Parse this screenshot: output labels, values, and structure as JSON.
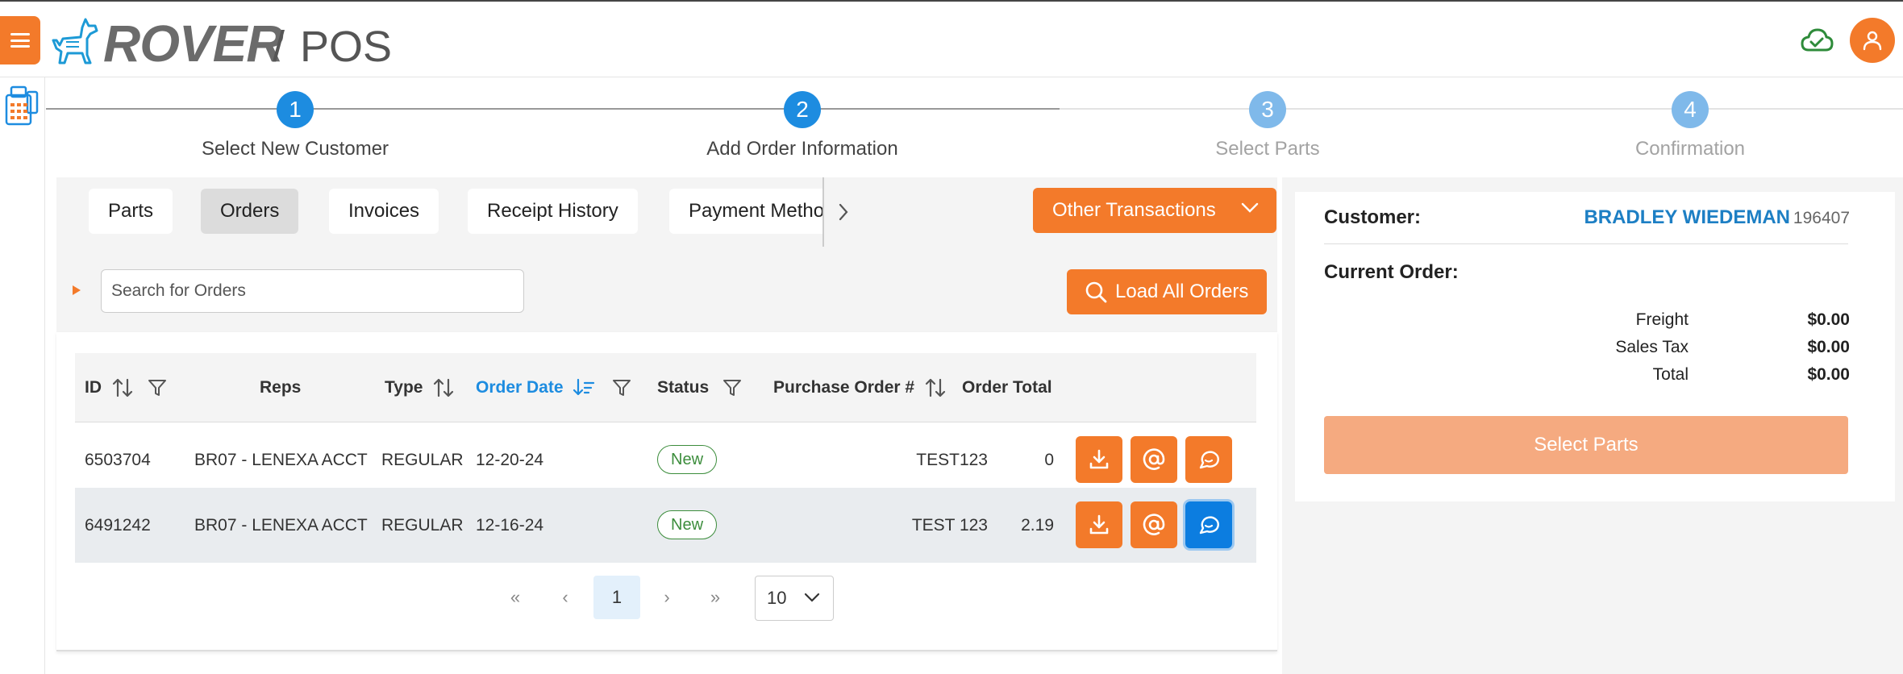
{
  "colors": {
    "accent": "#f37a2a",
    "step_active": "#1d8ce0",
    "step_inactive": "#7fb9ea",
    "link_blue": "#1d7fc4",
    "badge_green": "#3c8d3c",
    "button_disabled": "#f5aa80"
  },
  "header": {
    "menu_icon": "hamburger-icon",
    "logo_icon": "dog-icon",
    "brand": "ROVER",
    "separator": "/",
    "app": "POS",
    "sync_icon": "cloud-check-icon",
    "user_icon": "user-icon"
  },
  "left_rail": {
    "icon": "register-icon"
  },
  "stepper": {
    "steps": [
      {
        "number": "1",
        "label": "Select New Customer",
        "state": "active"
      },
      {
        "number": "2",
        "label": "Add Order Information",
        "state": "active"
      },
      {
        "number": "3",
        "label": "Select Parts",
        "state": "inactive"
      },
      {
        "number": "4",
        "label": "Confirmation",
        "state": "inactive"
      }
    ]
  },
  "tabs": {
    "items": [
      {
        "label": "Parts"
      },
      {
        "label": "Orders",
        "active": true
      },
      {
        "label": "Invoices"
      },
      {
        "label": "Receipt History"
      },
      {
        "label": "Payment Metho"
      }
    ],
    "next_icon": "chevron-right-icon",
    "other_transactions": "Other Transactions"
  },
  "search": {
    "placeholder": "Search for Orders",
    "value": "",
    "load_all": "Load All Orders"
  },
  "table": {
    "columns": [
      "ID",
      "Reps",
      "Type",
      "Order Date",
      "Status",
      "Purchase Order #",
      "Order Total"
    ],
    "sorted_column": "Order Date",
    "rows": [
      {
        "id": "6503704",
        "reps": "BR07 - LENEXA ACCT",
        "type": "REGULAR",
        "order_date": "12-20-24",
        "status": "New",
        "po": "TEST123",
        "total": "0"
      },
      {
        "id": "6491242",
        "reps": "BR07 - LENEXA ACCT",
        "type": "REGULAR",
        "order_date": "12-16-24",
        "status": "New",
        "po": "TEST 123",
        "total": "2.19"
      }
    ],
    "actions": [
      "download-icon",
      "email-icon",
      "chat-icon"
    ]
  },
  "pagination": {
    "first": "«",
    "prev": "‹",
    "current_page": "1",
    "next": "›",
    "last": "»",
    "page_size": "10"
  },
  "summary": {
    "customer_label": "Customer:",
    "customer_name": "BRADLEY WIEDEMAN",
    "customer_id": "196407",
    "current_order_label": "Current Order:",
    "freight_label": "Freight",
    "freight_value": "$0.00",
    "tax_label": "Sales Tax",
    "tax_value": "$0.00",
    "total_label": "Total",
    "total_value": "$0.00",
    "select_parts": "Select Parts"
  }
}
